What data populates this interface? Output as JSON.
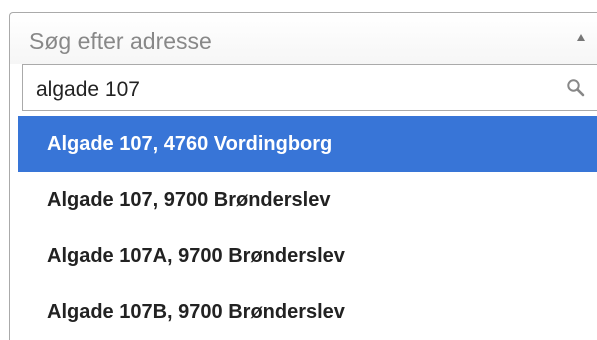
{
  "select": {
    "placeholder": "Søg efter adresse",
    "arrow_icon": "triangle-up-icon"
  },
  "search": {
    "value": "algade 107",
    "icon": "magnifier-icon"
  },
  "results": [
    {
      "label": "Algade 107, 4760 Vordingborg",
      "highlighted": true
    },
    {
      "label": "Algade 107, 9700 Brønderslev",
      "highlighted": false
    },
    {
      "label": "Algade 107A, 9700 Brønderslev",
      "highlighted": false
    },
    {
      "label": "Algade 107B, 9700 Brønderslev",
      "highlighted": false
    }
  ],
  "colors": {
    "highlight": "#3875d7",
    "border": "#aaaaaa",
    "placeholder_text": "#888888"
  }
}
